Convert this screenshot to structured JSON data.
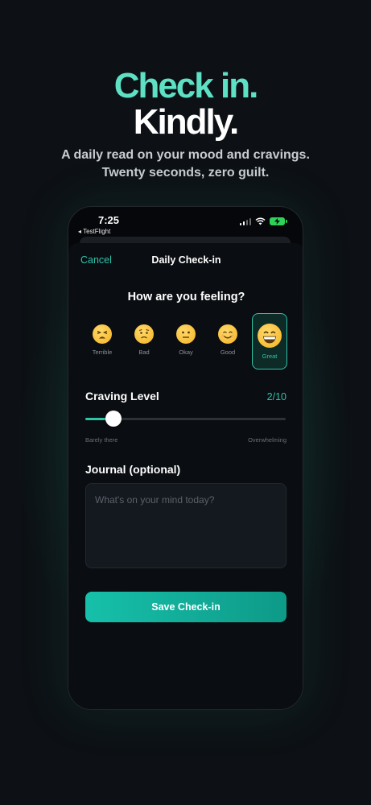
{
  "hero": {
    "title_line1": "Check in.",
    "title_line2": "Kindly.",
    "subtitle_line1": "A daily read on your mood and cravings.",
    "subtitle_line2": "Twenty seconds, zero guilt."
  },
  "status_bar": {
    "time": "7:25",
    "back_app": "◂ TestFlight"
  },
  "nav": {
    "cancel_label": "Cancel",
    "title": "Daily Check-in"
  },
  "mood": {
    "question": "How are you feeling?",
    "options": [
      {
        "label": "Terrible",
        "icon": "tired-face-icon"
      },
      {
        "label": "Bad",
        "icon": "worried-face-icon"
      },
      {
        "label": "Okay",
        "icon": "neutral-face-icon"
      },
      {
        "label": "Good",
        "icon": "smiling-face-icon"
      },
      {
        "label": "Great",
        "icon": "grinning-face-icon"
      }
    ],
    "selected": "Great"
  },
  "craving": {
    "title": "Craving Level",
    "value_text": "2/10",
    "value": 2,
    "max": 10,
    "min_label": "Barely there",
    "max_label": "Overwhelming"
  },
  "journal": {
    "title": "Journal (optional)",
    "placeholder": "What's on your mind today?"
  },
  "save_label": "Save Check-in",
  "colors": {
    "accent": "#2ec4a8",
    "hero_accent": "#5ee0c4",
    "background": "#0d1115"
  }
}
